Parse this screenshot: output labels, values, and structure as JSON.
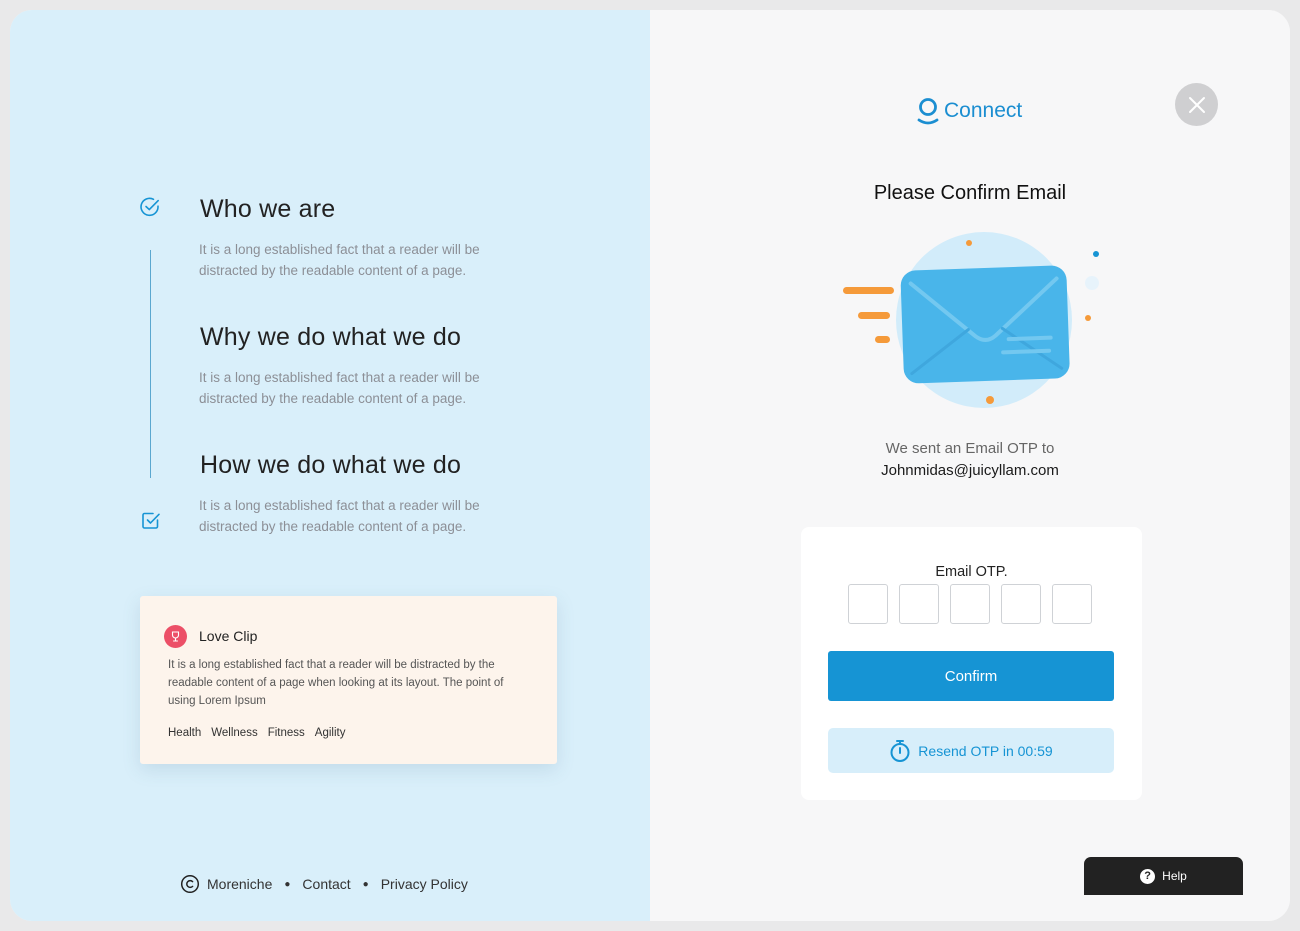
{
  "sections": [
    {
      "title": "Who we are",
      "text": "It is a long established fact that a reader will be distracted by the readable content of a page."
    },
    {
      "title": "Why we do what we do",
      "text": "It is a long established fact that a reader will be distracted by the readable content of a page."
    },
    {
      "title": "How we do what we do",
      "text": "It is a long established fact that a reader will be distracted by the readable content of a page."
    }
  ],
  "card": {
    "title": "Love Clip",
    "text": "It is a long established fact that a reader will be distracted by the readable content of a page when looking at its layout. The point of using Lorem Ipsum",
    "tags": [
      "Health",
      "Wellness",
      "Fitness",
      "Agility"
    ]
  },
  "footer": {
    "brand": "Moreniche",
    "links": [
      "Contact",
      "Privacy Policy"
    ]
  },
  "logo": {
    "text": "Connect"
  },
  "heading": "Please Confirm Email",
  "sent_message": "We sent an Email OTP to",
  "email": "Johnmidas@juicyllam.com",
  "otp": {
    "label": "Email OTP.",
    "digits": [
      "",
      "",
      "",
      "",
      ""
    ],
    "confirm_label": "Confirm",
    "resend_label": "Resend OTP in 00:59"
  },
  "help_label": "Help",
  "colors": {
    "accent": "#1694d4",
    "left_panel": "#d9effa",
    "card_bg": "#fdf4ec",
    "badge": "#ec4f67",
    "envelope": "#49b5ea",
    "orange": "#f59a3a"
  }
}
